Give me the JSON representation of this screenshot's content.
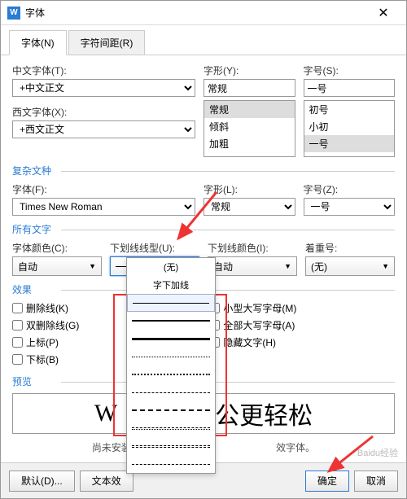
{
  "titlebar": {
    "title": "字体"
  },
  "tabs": {
    "font": "字体(N)",
    "spacing": "字符间距(R)"
  },
  "sec1": {
    "cn_font_label": "中文字体(T):",
    "cn_font_value": "+中文正文",
    "style_label": "字形(Y):",
    "style_value": "常规",
    "style_options": [
      "常规",
      "倾斜",
      "加粗"
    ],
    "size_label": "字号(S):",
    "size_value": "一号",
    "size_options": [
      "初号",
      "小初",
      "一号"
    ],
    "west_font_label": "西文字体(X):",
    "west_font_value": "+西文正文"
  },
  "sec2": {
    "title": "复杂文种",
    "font_label": "字体(F):",
    "font_value": "Times New Roman",
    "style_label": "字形(L):",
    "style_value": "常规",
    "size_label": "字号(Z):",
    "size_value": "一号"
  },
  "sec3": {
    "title": "所有文字",
    "color_label": "字体颜色(C):",
    "color_value": "自动",
    "underline_label": "下划线线型(U):",
    "underline_color_label": "下划线颜色(I):",
    "underline_color_value": "自动",
    "emphasis_label": "着重号:",
    "emphasis_value": "(无)"
  },
  "underline_dd": {
    "none": "(无)",
    "words_only": "字下加线",
    "options_count": 12
  },
  "sec4": {
    "title": "效果",
    "left": [
      "删除线(K)",
      "双删除线(G)",
      "上标(P)",
      "下标(B)"
    ],
    "right": [
      "小型大写字母(M)",
      "全部大写字母(A)",
      "隐藏文字(H)"
    ]
  },
  "preview": {
    "title": "预览",
    "text_left": "W",
    "text_right": "公更轻松",
    "hint_left": "尚未安装此字体，打印",
    "hint_right": "效字体。"
  },
  "footer": {
    "default_btn": "默认(D)...",
    "text_effect_btn": "文本效",
    "ok_btn": "确定",
    "cancel_btn": "取消"
  },
  "watermark": "Baidu经验"
}
